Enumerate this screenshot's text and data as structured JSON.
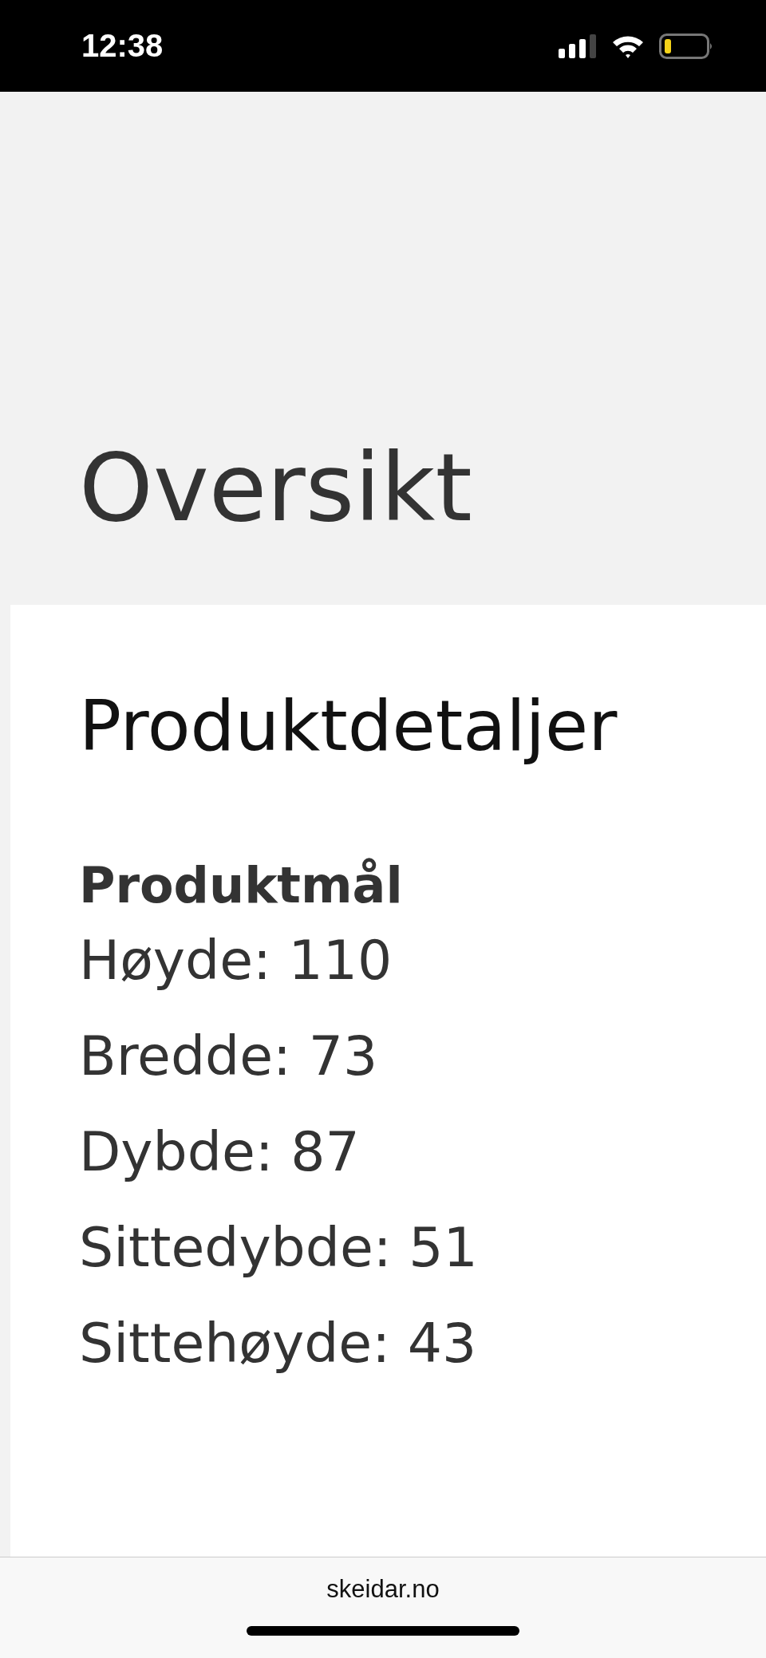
{
  "status_bar": {
    "time": "12:38"
  },
  "header": {
    "title": "Oversikt"
  },
  "details": {
    "title": "Produktdetaljer",
    "section_title": "Produktmål",
    "specs": [
      "Høyde: 110",
      "Bredde: 73",
      "Dybde: 87",
      "Sittedybde: 51",
      "Sittehøyde: 43"
    ]
  },
  "browser_bar": {
    "url": "skeidar.no"
  }
}
